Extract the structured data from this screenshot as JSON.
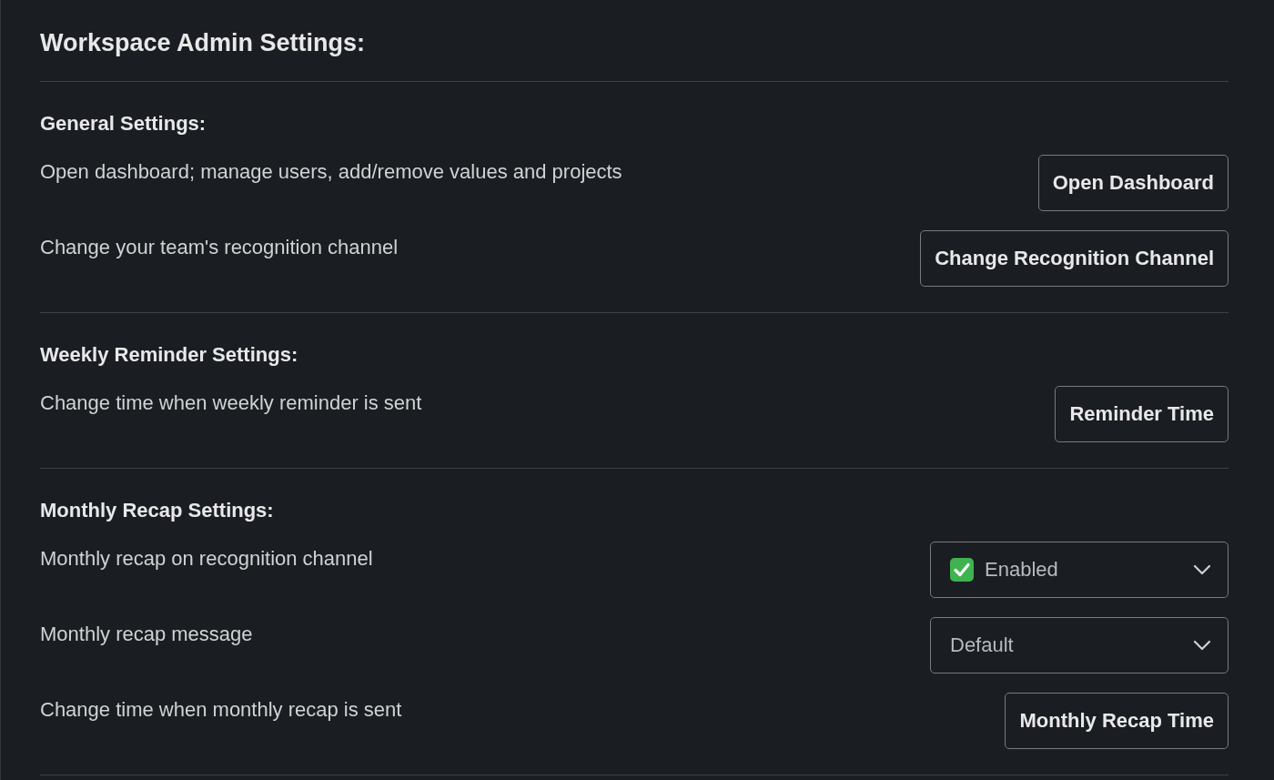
{
  "title": "Workspace Admin Settings:",
  "sections": [
    {
      "heading": "General Settings:",
      "rows": [
        {
          "kind": "button",
          "label": "Open dashboard; manage users, add/remove values and projects",
          "control": "Open Dashboard"
        },
        {
          "kind": "button",
          "label": "Change your team's recognition channel",
          "control": "Change Recognition Channel"
        }
      ]
    },
    {
      "heading": "Weekly Reminder Settings:",
      "rows": [
        {
          "kind": "button",
          "label": "Change time when weekly reminder is sent",
          "control": "Reminder Time"
        }
      ]
    },
    {
      "heading": "Monthly Recap Settings:",
      "rows": [
        {
          "kind": "select",
          "label": "Monthly recap on recognition channel",
          "control": "Enabled",
          "checked": true
        },
        {
          "kind": "select",
          "label": "Monthly recap message",
          "control": "Default",
          "checked": false
        },
        {
          "kind": "button",
          "label": "Change time when monthly recap is sent",
          "control": "Monthly Recap Time"
        }
      ]
    }
  ]
}
